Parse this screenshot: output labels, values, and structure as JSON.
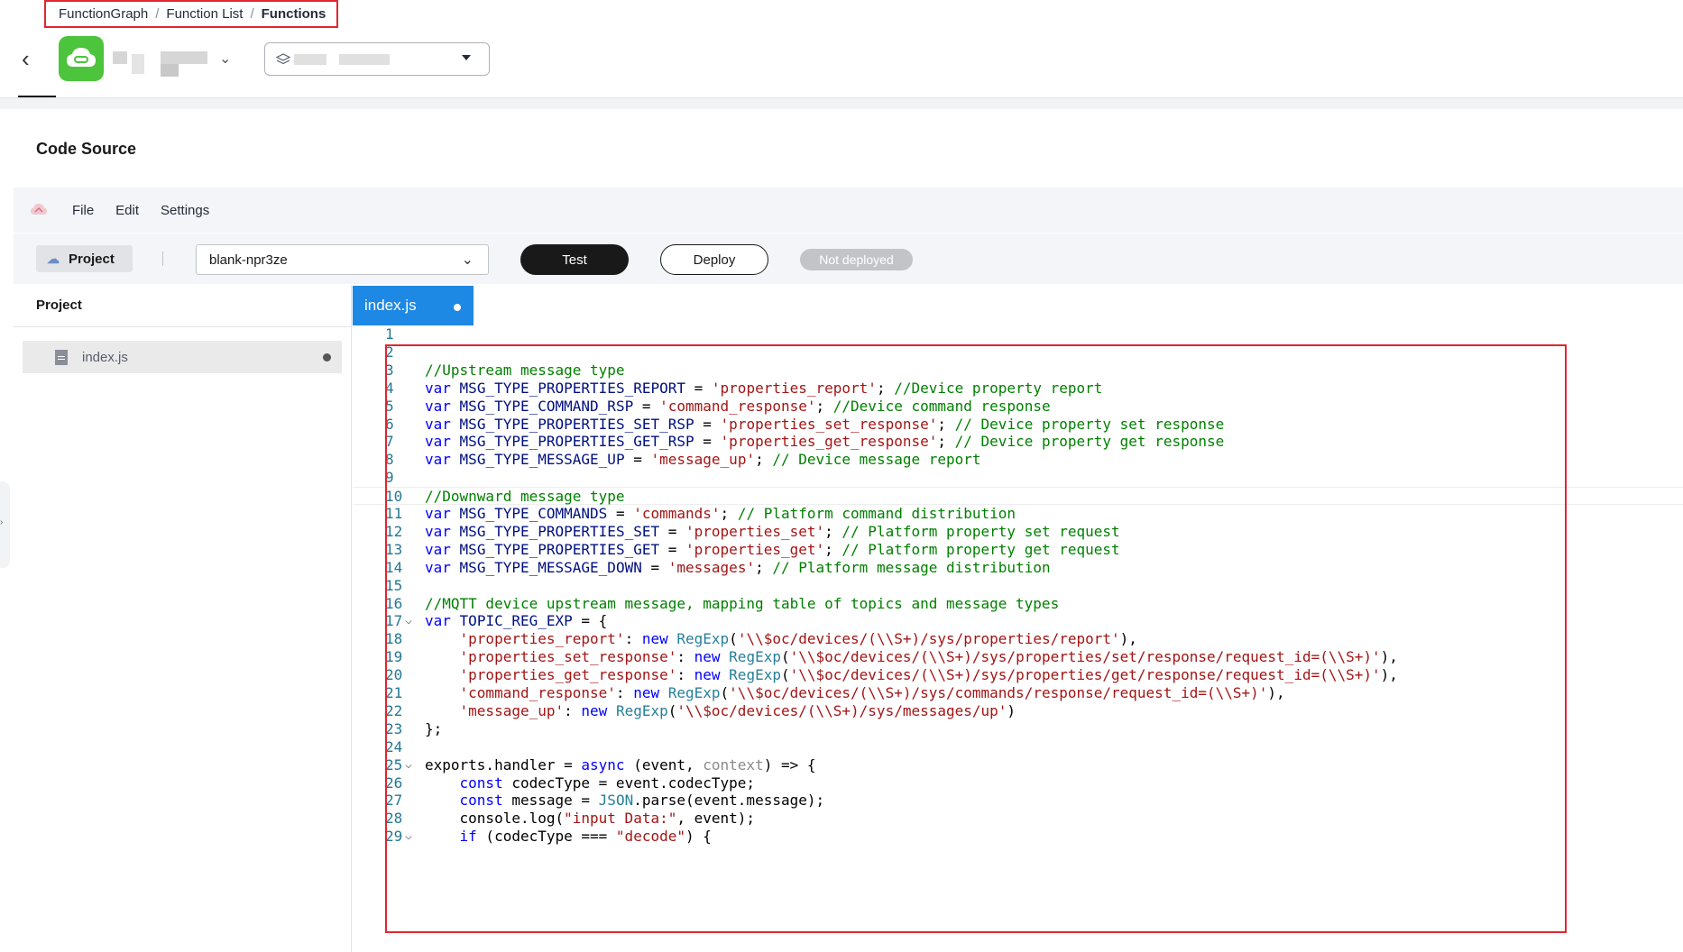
{
  "breadcrumb": {
    "items": [
      "FunctionGraph",
      "Function List",
      "Functions"
    ],
    "separator": "/"
  },
  "header": {
    "back_icon": "‹",
    "chevron": "⌄"
  },
  "code_source": {
    "title": "Code Source",
    "menu": [
      "File",
      "Edit",
      "Settings"
    ]
  },
  "toolbar": {
    "project_label": "Project",
    "project_select_value": "blank-npr3ze",
    "test_label": "Test",
    "deploy_label": "Deploy",
    "status_badge": "Not deployed"
  },
  "project_panel": {
    "title": "Project",
    "files": [
      {
        "name": "index.js",
        "modified": true
      }
    ]
  },
  "editor": {
    "tab": {
      "name": "index.js",
      "modified": true
    },
    "active_line": 10,
    "lines": [
      {
        "n": "1",
        "fold": false,
        "parts": []
      },
      {
        "n": "2",
        "fold": false,
        "parts": []
      },
      {
        "n": "3",
        "fold": false,
        "parts": [
          [
            "cm",
            "//Upstream message type"
          ]
        ]
      },
      {
        "n": "4",
        "fold": false,
        "parts": [
          [
            "kw",
            "var"
          ],
          [
            "p",
            " "
          ],
          [
            "vn",
            "MSG_TYPE_PROPERTIES_REPORT"
          ],
          [
            "p",
            " = "
          ],
          [
            "str",
            "'properties_report'"
          ],
          [
            "p",
            "; "
          ],
          [
            "cm",
            "//Device property report"
          ]
        ]
      },
      {
        "n": "5",
        "fold": false,
        "parts": [
          [
            "kw",
            "var"
          ],
          [
            "p",
            " "
          ],
          [
            "vn",
            "MSG_TYPE_COMMAND_RSP"
          ],
          [
            "p",
            " = "
          ],
          [
            "str",
            "'command_response'"
          ],
          [
            "p",
            "; "
          ],
          [
            "cm",
            "//Device command response"
          ]
        ]
      },
      {
        "n": "6",
        "fold": false,
        "parts": [
          [
            "kw",
            "var"
          ],
          [
            "p",
            " "
          ],
          [
            "vn",
            "MSG_TYPE_PROPERTIES_SET_RSP"
          ],
          [
            "p",
            " = "
          ],
          [
            "str",
            "'properties_set_response'"
          ],
          [
            "p",
            "; "
          ],
          [
            "cm",
            "// Device property set response"
          ]
        ]
      },
      {
        "n": "7",
        "fold": false,
        "parts": [
          [
            "kw",
            "var"
          ],
          [
            "p",
            " "
          ],
          [
            "vn",
            "MSG_TYPE_PROPERTIES_GET_RSP"
          ],
          [
            "p",
            " = "
          ],
          [
            "str",
            "'properties_get_response'"
          ],
          [
            "p",
            "; "
          ],
          [
            "cm",
            "// Device property get response"
          ]
        ]
      },
      {
        "n": "8",
        "fold": false,
        "parts": [
          [
            "kw",
            "var"
          ],
          [
            "p",
            " "
          ],
          [
            "vn",
            "MSG_TYPE_MESSAGE_UP"
          ],
          [
            "p",
            " = "
          ],
          [
            "str",
            "'message_up'"
          ],
          [
            "p",
            "; "
          ],
          [
            "cm",
            "// Device message report"
          ]
        ]
      },
      {
        "n": "9",
        "fold": false,
        "parts": []
      },
      {
        "n": "10",
        "fold": false,
        "parts": [
          [
            "cm",
            "//Downward message type"
          ]
        ]
      },
      {
        "n": "11",
        "fold": false,
        "parts": [
          [
            "kw",
            "var"
          ],
          [
            "p",
            " "
          ],
          [
            "vn",
            "MSG_TYPE_COMMANDS"
          ],
          [
            "p",
            " = "
          ],
          [
            "str",
            "'commands'"
          ],
          [
            "p",
            "; "
          ],
          [
            "cm",
            "// Platform command distribution"
          ]
        ]
      },
      {
        "n": "12",
        "fold": false,
        "parts": [
          [
            "kw",
            "var"
          ],
          [
            "p",
            " "
          ],
          [
            "vn",
            "MSG_TYPE_PROPERTIES_SET"
          ],
          [
            "p",
            " = "
          ],
          [
            "str",
            "'properties_set'"
          ],
          [
            "p",
            "; "
          ],
          [
            "cm",
            "// Platform property set request"
          ]
        ]
      },
      {
        "n": "13",
        "fold": false,
        "parts": [
          [
            "kw",
            "var"
          ],
          [
            "p",
            " "
          ],
          [
            "vn",
            "MSG_TYPE_PROPERTIES_GET"
          ],
          [
            "p",
            " = "
          ],
          [
            "str",
            "'properties_get'"
          ],
          [
            "p",
            "; "
          ],
          [
            "cm",
            "// Platform property get request"
          ]
        ]
      },
      {
        "n": "14",
        "fold": false,
        "parts": [
          [
            "kw",
            "var"
          ],
          [
            "p",
            " "
          ],
          [
            "vn",
            "MSG_TYPE_MESSAGE_DOWN"
          ],
          [
            "p",
            " = "
          ],
          [
            "str",
            "'messages'"
          ],
          [
            "p",
            "; "
          ],
          [
            "cm",
            "// Platform message distribution"
          ]
        ]
      },
      {
        "n": "15",
        "fold": false,
        "parts": []
      },
      {
        "n": "16",
        "fold": false,
        "parts": [
          [
            "cm",
            "//MQTT device upstream message, mapping table of topics and message types"
          ]
        ]
      },
      {
        "n": "17",
        "fold": true,
        "parts": [
          [
            "kw",
            "var"
          ],
          [
            "p",
            " "
          ],
          [
            "vn",
            "TOPIC_REG_EXP"
          ],
          [
            "p",
            " = {"
          ]
        ]
      },
      {
        "n": "18",
        "fold": false,
        "parts": [
          [
            "p",
            "    "
          ],
          [
            "str",
            "'properties_report'"
          ],
          [
            "p",
            ": "
          ],
          [
            "kw",
            "new"
          ],
          [
            "p",
            " "
          ],
          [
            "cls",
            "RegExp"
          ],
          [
            "p",
            "("
          ],
          [
            "str",
            "'\\\\$oc/devices/(\\\\S+)/sys/properties/report'"
          ],
          [
            "p",
            "),"
          ]
        ]
      },
      {
        "n": "19",
        "fold": false,
        "parts": [
          [
            "p",
            "    "
          ],
          [
            "str",
            "'properties_set_response'"
          ],
          [
            "p",
            ": "
          ],
          [
            "kw",
            "new"
          ],
          [
            "p",
            " "
          ],
          [
            "cls",
            "RegExp"
          ],
          [
            "p",
            "("
          ],
          [
            "str",
            "'\\\\$oc/devices/(\\\\S+)/sys/properties/set/response/request_id=(\\\\S+)'"
          ],
          [
            "p",
            "),"
          ]
        ]
      },
      {
        "n": "20",
        "fold": false,
        "parts": [
          [
            "p",
            "    "
          ],
          [
            "str",
            "'properties_get_response'"
          ],
          [
            "p",
            ": "
          ],
          [
            "kw",
            "new"
          ],
          [
            "p",
            " "
          ],
          [
            "cls",
            "RegExp"
          ],
          [
            "p",
            "("
          ],
          [
            "str",
            "'\\\\$oc/devices/(\\\\S+)/sys/properties/get/response/request_id=(\\\\S+)'"
          ],
          [
            "p",
            "),"
          ]
        ]
      },
      {
        "n": "21",
        "fold": false,
        "parts": [
          [
            "p",
            "    "
          ],
          [
            "str",
            "'command_response'"
          ],
          [
            "p",
            ": "
          ],
          [
            "kw",
            "new"
          ],
          [
            "p",
            " "
          ],
          [
            "cls",
            "RegExp"
          ],
          [
            "p",
            "("
          ],
          [
            "str",
            "'\\\\$oc/devices/(\\\\S+)/sys/commands/response/request_id=(\\\\S+)'"
          ],
          [
            "p",
            "),"
          ]
        ]
      },
      {
        "n": "22",
        "fold": false,
        "parts": [
          [
            "p",
            "    "
          ],
          [
            "str",
            "'message_up'"
          ],
          [
            "p",
            ": "
          ],
          [
            "kw",
            "new"
          ],
          [
            "p",
            " "
          ],
          [
            "cls",
            "RegExp"
          ],
          [
            "p",
            "("
          ],
          [
            "str",
            "'\\\\$oc/devices/(\\\\S+)/sys/messages/up'"
          ],
          [
            "p",
            ")"
          ]
        ]
      },
      {
        "n": "23",
        "fold": false,
        "parts": [
          [
            "p",
            "};"
          ]
        ]
      },
      {
        "n": "24",
        "fold": false,
        "parts": []
      },
      {
        "n": "25",
        "fold": true,
        "parts": [
          [
            "p",
            "exports.handler = "
          ],
          [
            "kw",
            "async"
          ],
          [
            "p",
            " (event, "
          ],
          [
            "par",
            "context"
          ],
          [
            "p",
            ") => {"
          ]
        ]
      },
      {
        "n": "26",
        "fold": false,
        "parts": [
          [
            "p",
            "    "
          ],
          [
            "kw",
            "const"
          ],
          [
            "p",
            " codecType = event.codecType;"
          ]
        ]
      },
      {
        "n": "27",
        "fold": false,
        "parts": [
          [
            "p",
            "    "
          ],
          [
            "kw",
            "const"
          ],
          [
            "p",
            " message = "
          ],
          [
            "cls",
            "JSON"
          ],
          [
            "p",
            ".parse(event.message);"
          ]
        ]
      },
      {
        "n": "28",
        "fold": false,
        "parts": [
          [
            "p",
            "    console.log("
          ],
          [
            "str",
            "\"input Data:\""
          ],
          [
            "p",
            ", event);"
          ]
        ]
      },
      {
        "n": "29",
        "fold": true,
        "parts": [
          [
            "p",
            "    "
          ],
          [
            "kw",
            "if"
          ],
          [
            "p",
            " (codecType === "
          ],
          [
            "str",
            "\"decode\""
          ],
          [
            "p",
            ") {"
          ]
        ]
      }
    ]
  },
  "colors": {
    "accent": "#1e88e5",
    "highlight_box": "#e0262f",
    "logo": "#4cc43c"
  },
  "icons": [
    "back-arrow-icon",
    "function-logo-icon",
    "chevron-down-icon",
    "layers-icon",
    "cloud-logo-icon",
    "project-icon",
    "file-icon"
  ]
}
